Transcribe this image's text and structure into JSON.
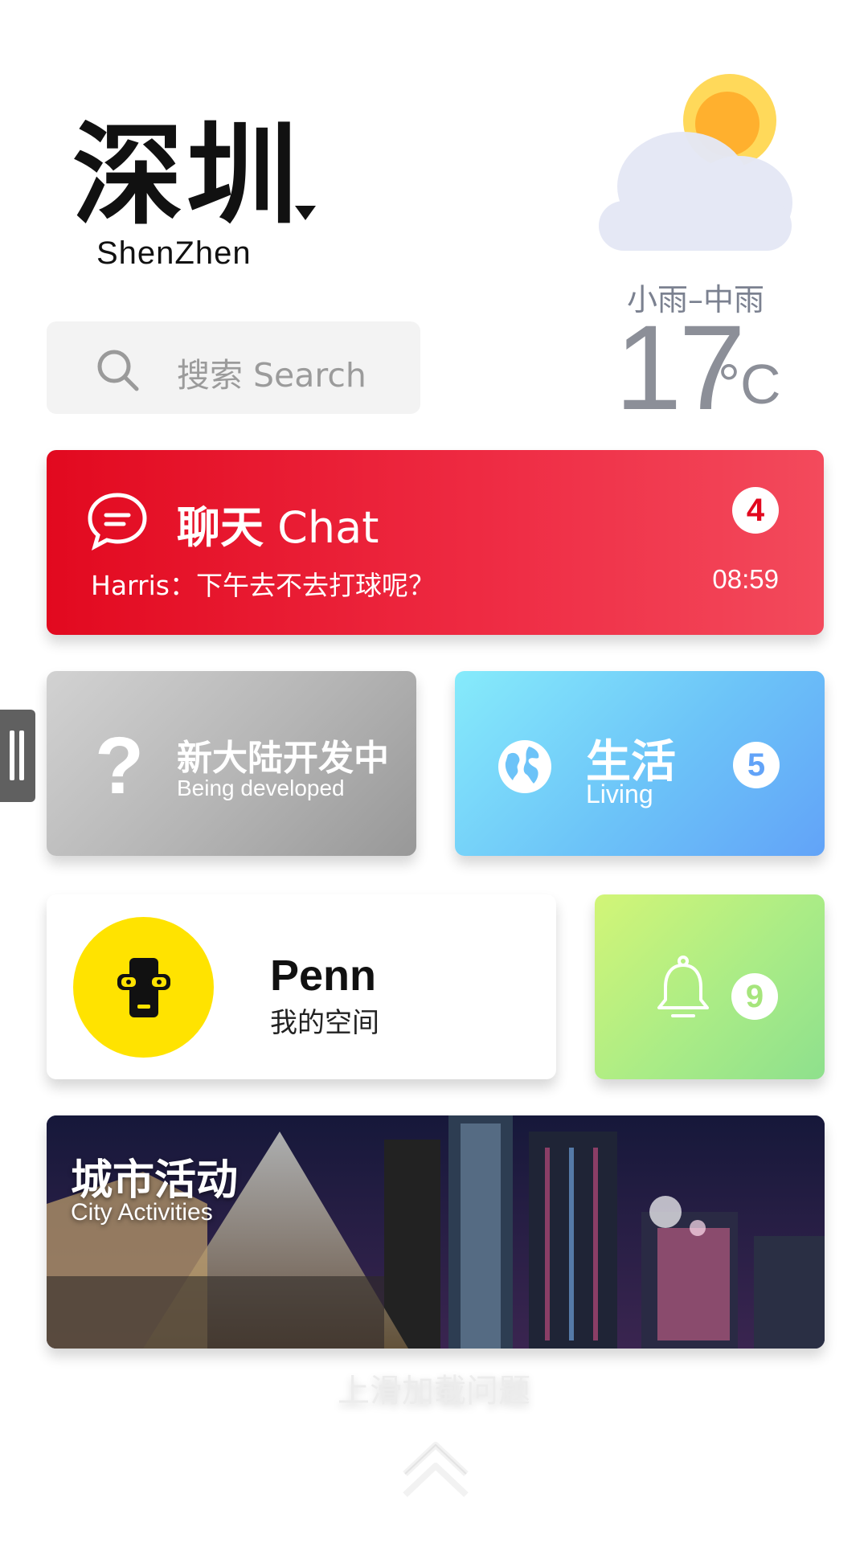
{
  "header": {
    "city_cn": "深圳",
    "city_en": "ShenZhen"
  },
  "weather": {
    "icon": "cloud-sun-icon",
    "condition": "小雨–中雨",
    "temperature": "17",
    "unit": "°C"
  },
  "search": {
    "placeholder": "搜索 Search",
    "icon": "search-icon"
  },
  "chat": {
    "title_cn": "聊天",
    "title_en": "Chat",
    "message": "Harris：下午去不去打球呢？",
    "time": "08:59",
    "badge": "4",
    "icon": "chat-bubble-icon",
    "color": "#e2091f"
  },
  "developing": {
    "title": "新大陆开发中",
    "subtitle": "Being developed",
    "icon": "question-mark-icon"
  },
  "living": {
    "title": "生活",
    "subtitle": "Living",
    "badge": "5",
    "icon": "globe-icon",
    "color": "#62a3f8"
  },
  "profile": {
    "name": "Penn",
    "subtitle": "我的空间",
    "avatar_icon": "nerd-phone-icon",
    "avatar_color": "#ffe300"
  },
  "notifications": {
    "badge": "9",
    "icon": "bell-icon",
    "color": "#a6e57c"
  },
  "city_activities": {
    "title": "城市活动",
    "subtitle": "City Activities"
  },
  "footer": {
    "load_more": "上滑加载问题",
    "icon": "double-chevron-up-icon"
  }
}
